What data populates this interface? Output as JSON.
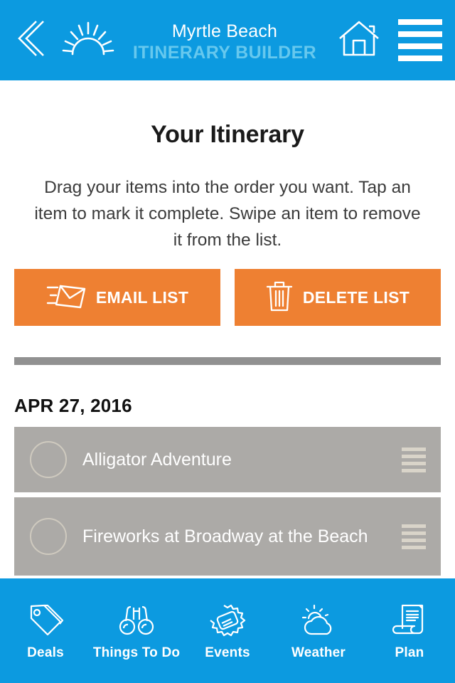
{
  "header": {
    "back_icon": "chevron-left-icon",
    "logo_icon": "sunrise-icon",
    "title": "Myrtle Beach",
    "subtitle": "ITINERARY BUILDER",
    "home_icon": "home-icon",
    "menu_icon": "hamburger-menu-icon",
    "background_color": "#0C9AE0",
    "subtitle_color": "#66C8EE"
  },
  "main": {
    "title": "Your Itinerary",
    "description": "Drag your items into the order you want. Tap an item to mark it complete. Swipe an item to remove it from the list.",
    "actions": [
      {
        "label": "EMAIL LIST",
        "icon": "email-envelope-icon",
        "color": "#EE8032"
      },
      {
        "label": "DELETE LIST",
        "icon": "trash-can-icon",
        "color": "#EE8032"
      }
    ],
    "divider_color": "#919191",
    "date_heading": "APR 27, 2016",
    "items": [
      {
        "label": "Alligator Adventure",
        "completed": false
      },
      {
        "label": "Fireworks at Broadway at the Beach",
        "completed": false
      },
      {
        "label": "",
        "completed": false
      }
    ],
    "item_background_color": "#ACAAA7",
    "swipe_action_color": "#92807F"
  },
  "bottom_nav": {
    "items": [
      {
        "label": "Deals",
        "icon": "price-tag-icon"
      },
      {
        "label": "Things To Do",
        "icon": "binoculars-icon"
      },
      {
        "label": "Events",
        "icon": "ticket-icon"
      },
      {
        "label": "Weather",
        "icon": "sun-cloud-icon"
      },
      {
        "label": "Plan",
        "icon": "scroll-document-icon"
      }
    ],
    "background_color": "#0C9AE0"
  }
}
